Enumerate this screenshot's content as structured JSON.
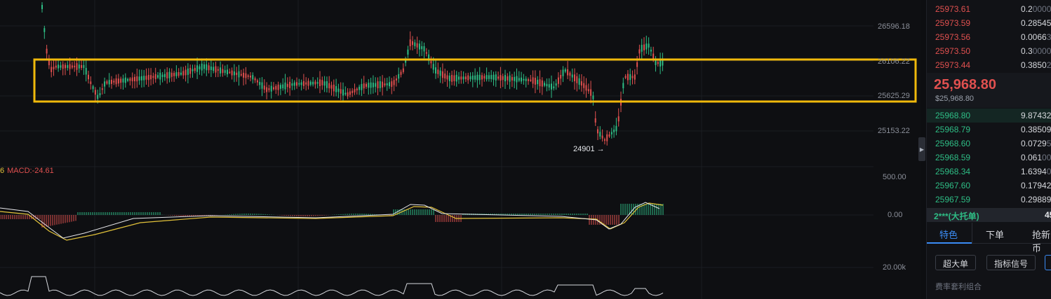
{
  "chart": {
    "price_axis": [
      "26596.18",
      "26106.22",
      "25625.29",
      "25153.22"
    ],
    "macd_axis": [
      "500.00",
      "0.00"
    ],
    "volume_axis": [
      "20.00k"
    ],
    "macd_legend_prefix": "6",
    "macd_legend": "MACD:-24.61",
    "low_marker": "24901",
    "low_marker_arrow": "→",
    "highlight_color": "#f0b90b",
    "up_color": "#2ebd85",
    "down_color": "#e0504f"
  },
  "orderbook": {
    "asks": [
      {
        "price": "25973.61",
        "qty": "0.2",
        "qty_dim": "0000"
      },
      {
        "price": "25973.59",
        "qty": "0.28545",
        "qty_dim": ""
      },
      {
        "price": "25973.56",
        "qty": "0.0066",
        "qty_dim": "3"
      },
      {
        "price": "25973.50",
        "qty": "0.3",
        "qty_dim": "0000"
      },
      {
        "price": "25973.44",
        "qty": "0.3850",
        "qty_dim": "2"
      }
    ],
    "last_price": "25,968.80",
    "last_price_sub": "$25,968.80",
    "bids": [
      {
        "price": "25968.80",
        "qty": "9.87432",
        "qty_dim": ""
      },
      {
        "price": "25968.79",
        "qty": "0.38509",
        "qty_dim": ""
      },
      {
        "price": "25968.60",
        "qty": "0.0729",
        "qty_dim": "5"
      },
      {
        "price": "25968.59",
        "qty": "0.061",
        "qty_dim": "00"
      },
      {
        "price": "25968.34",
        "qty": "1.6394",
        "qty_dim": "0"
      },
      {
        "price": "25967.60",
        "qty": "0.17942",
        "qty_dim": ""
      },
      {
        "price": "25967.59",
        "qty": "0.29889",
        "qty_dim": ""
      }
    ],
    "big_order_label": "2***(大托单)",
    "big_order_value": "45",
    "tabs": [
      "特色",
      "下单",
      "抢新币"
    ],
    "chips": [
      "超大单",
      "指标信号"
    ],
    "footnote": "费率套利组合"
  }
}
